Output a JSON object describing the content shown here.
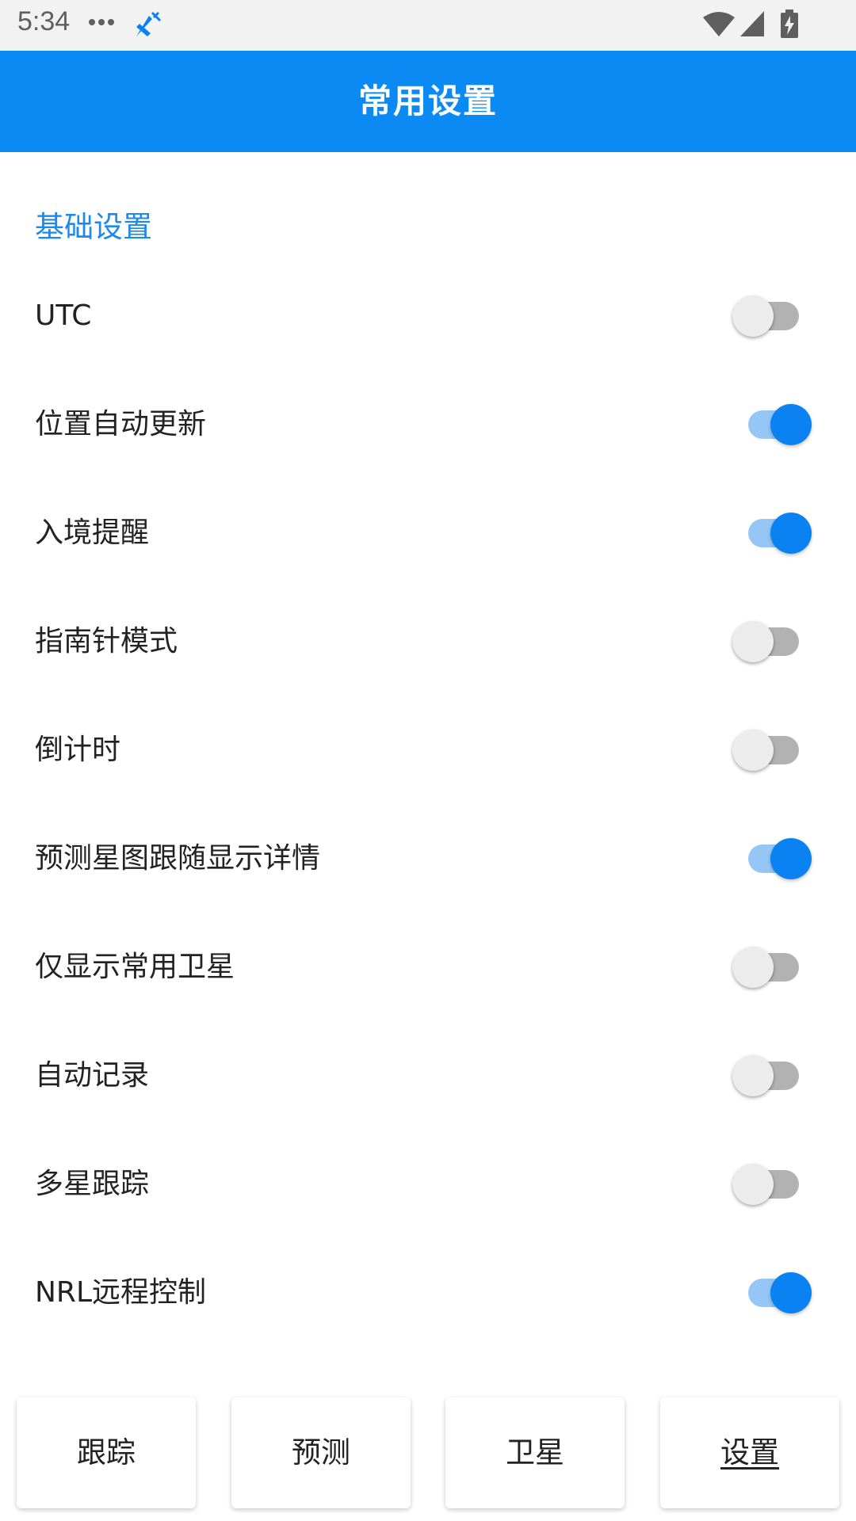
{
  "status_bar": {
    "time": "5:34",
    "icons": [
      "more-dots-icon",
      "satellite-icon",
      "wifi-icon",
      "cell-signal-icon",
      "battery-charging-icon"
    ],
    "accent_color": "#0b82f2"
  },
  "app_bar": {
    "title": "常用设置",
    "background_color": "#0b8af3"
  },
  "section": {
    "title": "基础设置"
  },
  "settings": [
    {
      "label": "UTC",
      "on": false
    },
    {
      "label": "位置自动更新",
      "on": true
    },
    {
      "label": "入境提醒",
      "on": true
    },
    {
      "label": "指南针模式",
      "on": false
    },
    {
      "label": "倒计时",
      "on": false
    },
    {
      "label": "预测星图跟随显示详情",
      "on": true
    },
    {
      "label": "仅显示常用卫星",
      "on": false
    },
    {
      "label": "自动记录",
      "on": false
    },
    {
      "label": "多星跟踪",
      "on": false
    },
    {
      "label": "NRL远程控制",
      "on": true
    }
  ],
  "bottom_nav": {
    "items": [
      {
        "label": "跟踪",
        "active": false
      },
      {
        "label": "预测",
        "active": false
      },
      {
        "label": "卫星",
        "active": false
      },
      {
        "label": "设置",
        "active": true
      }
    ]
  }
}
